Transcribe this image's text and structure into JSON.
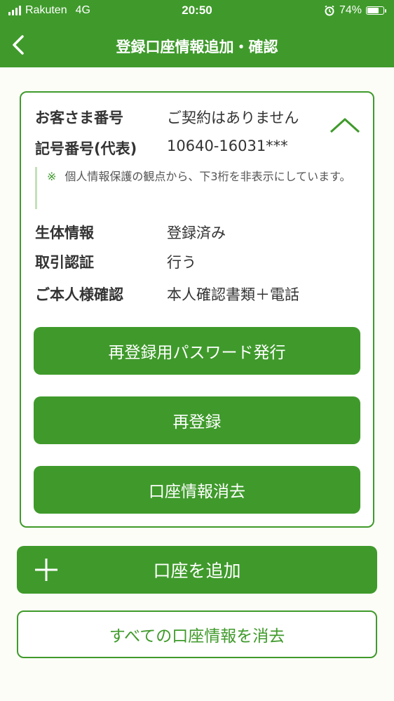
{
  "status_bar": {
    "carrier": "Rakuten",
    "network": "4G",
    "time": "20:50",
    "battery": "74%",
    "battery_level": 0.74,
    "icons": [
      "signal-icon",
      "alarm-icon",
      "battery-icon"
    ]
  },
  "header": {
    "title": "登録口座情報追加・確認",
    "back_icon": "chevron-left-icon"
  },
  "account": {
    "customer_number": {
      "label": "お客さま番号",
      "value": "ご契約はありません"
    },
    "account_number": {
      "label": "記号番号(代表)",
      "value": "10640-16031***"
    },
    "note": {
      "mark": "※",
      "text": "個人情報保護の観点から、下3桁を非表示にしています。"
    },
    "biometric": {
      "label": "生体情報",
      "value": "登録済み"
    },
    "transaction_auth": {
      "label": "取引認証",
      "value": "行う"
    },
    "identity_check": {
      "label": "ご本人様確認",
      "value": "本人確認書類＋電話"
    },
    "collapse_icon": "chevron-up-icon"
  },
  "buttons": {
    "reissue_password": "再登録用パスワード発行",
    "re_register": "再登録",
    "delete_account_info": "口座情報消去",
    "add_account": "口座を追加",
    "delete_all": "すべての口座情報を消去"
  },
  "colors": {
    "brand_green": "#3f9a2b",
    "background": "#fdfdf7",
    "note_border": "#c5e0b8"
  }
}
